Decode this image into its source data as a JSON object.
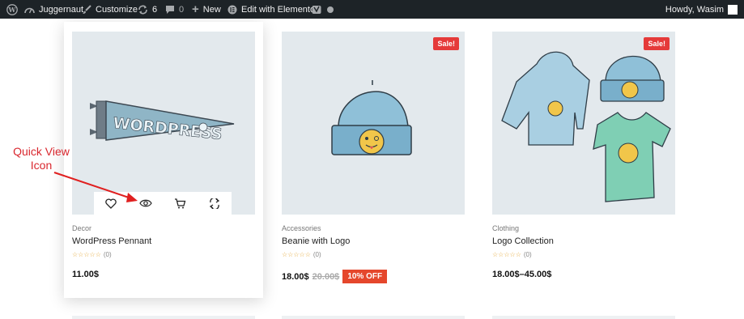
{
  "admin_bar": {
    "site_name": "Juggernaut",
    "customize": "Customize",
    "updates_count": "6",
    "comments_count": "0",
    "new_label": "New",
    "elementor_label": "Edit with Elementor",
    "howdy": "Howdy, Wasim"
  },
  "annotation": {
    "text": "Quick View Icon"
  },
  "products": [
    {
      "category": "Decor",
      "title": "WordPress Pennant",
      "rating_count": "(0)",
      "price": "11.00$",
      "image": "pennant",
      "actions": [
        "heart-icon",
        "eye-icon",
        "cart-icon",
        "compare-icon"
      ]
    },
    {
      "category": "Accessories",
      "title": "Beanie with Logo",
      "rating_count": "(0)",
      "price": "18.00$",
      "old_price": "20.00$",
      "discount": "10% OFF",
      "sale_badge": "Sale!",
      "image": "beanie"
    },
    {
      "category": "Clothing",
      "title": "Logo Collection",
      "rating_count": "(0)",
      "price": "18.00$–45.00$",
      "sale_badge": "Sale!",
      "image": "collection"
    }
  ],
  "colors": {
    "admin_bar": "#1d2327",
    "sale": "#e53a3a",
    "discount": "#e5472c",
    "annotation": "#d9272e",
    "thumb_bg": "#e3e9ed"
  }
}
